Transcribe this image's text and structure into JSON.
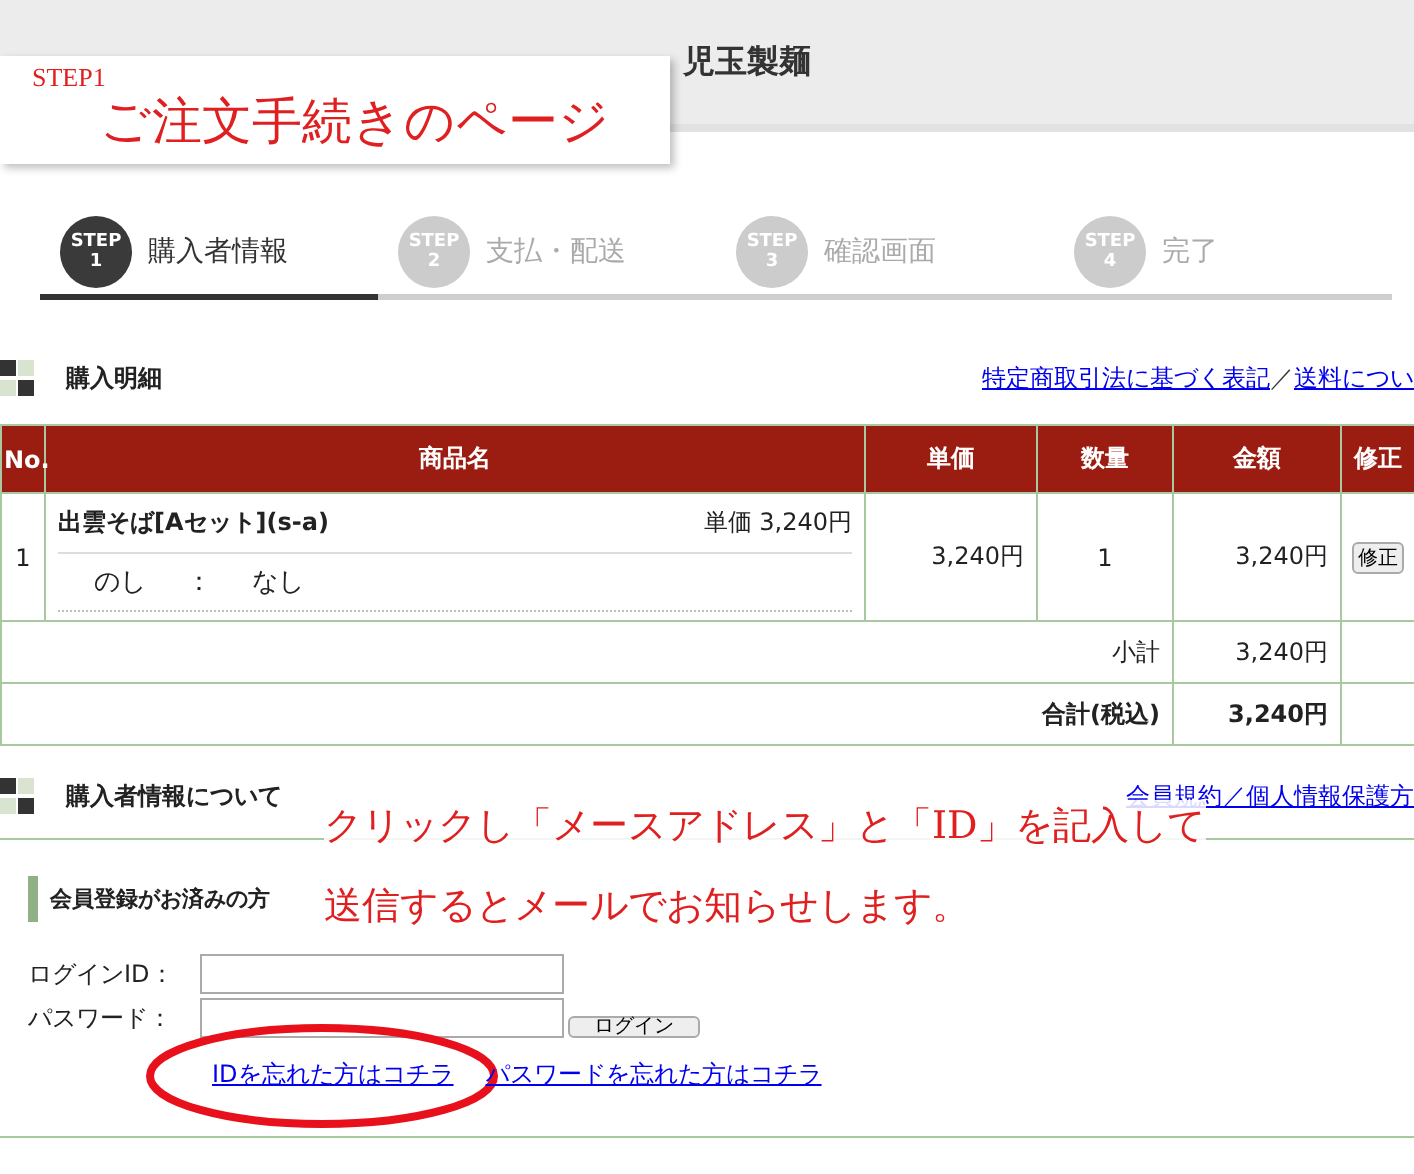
{
  "header": {
    "title": "児玉製麺"
  },
  "annotation_top": {
    "step": "STEP1",
    "title": "ご注文手続きのページ"
  },
  "steps": [
    {
      "badge": "STEP",
      "number": "1",
      "label": "購入者情報",
      "selected": true
    },
    {
      "badge": "STEP",
      "number": "2",
      "label": "支払・配送",
      "selected": false
    },
    {
      "badge": "STEP",
      "number": "3",
      "label": "確認画面",
      "selected": false
    },
    {
      "badge": "STEP",
      "number": "4",
      "label": "完了",
      "selected": false
    }
  ],
  "order": {
    "heading": "購入明細",
    "links": [
      "特定商取引法に基づく表記",
      "送料につい"
    ],
    "separator": "／",
    "columns": [
      "No.",
      "商品名",
      "単価",
      "数量",
      "金額",
      "修正"
    ],
    "rows": [
      {
        "no": "1",
        "name": "出雲そば[Aセット](s-a)",
        "unit_note": "単価 3,240円",
        "option_label": "のし",
        "option_sep": "：",
        "option_value": "なし",
        "price": "3,240円",
        "qty": "1",
        "amount": "3,240円",
        "edit": "修正"
      }
    ],
    "subtotal_label": "小計",
    "subtotal": "3,240円",
    "total_label": "合計(税込)",
    "total": "3,240円"
  },
  "buyer": {
    "heading": "購入者情報について",
    "link": "会員規約／個人情報保護方",
    "member_heading": "会員登録がお済みの方",
    "id_label": "ログインID：",
    "password_label": "パスワード：",
    "login_button": "ログイン",
    "forgot_links": [
      {
        "text": "IDを忘れた方はコチラ",
        "circled": true
      },
      {
        "text": "パスワードを忘れた方はコチラ",
        "circled": false
      }
    ]
  },
  "annotation_bottom": [
    "クリックし「メースアドレス」と「ID」を記入して",
    "送信するとメールでお知らせします。"
  ]
}
